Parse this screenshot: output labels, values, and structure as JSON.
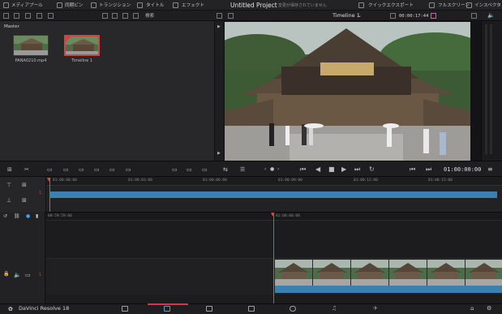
{
  "topbar": {
    "media_pool": "メディアプール",
    "sync_bin": "同期ビン",
    "transitions": "トランジション",
    "titles": "タイトル",
    "effects": "エフェクト",
    "project_title": "Untitled Project",
    "save_status": "変更が保存されていません",
    "quick_export": "クイックエクスポート",
    "fullscreen": "フルスクリーン",
    "inspector": "インスペクタ"
  },
  "toolbar2": {
    "search_label": "検索",
    "timeline_name": "Timeline 1",
    "timecode": "00:00:17:44"
  },
  "media_pool": {
    "bin_label": "Master",
    "clips": [
      {
        "name": "PANA0210.mp4"
      },
      {
        "name": "Timeline 1"
      }
    ]
  },
  "controls": {
    "main_timecode": "01:00:00:00"
  },
  "upper_timeline": {
    "track_number": "1",
    "ruler": [
      "01:00:00:00",
      "01:00:03:00",
      "01:00:06:00",
      "01:00:09:00",
      "01:00:12:00",
      "01:00:15:00"
    ]
  },
  "lower_timeline": {
    "track_number": "1",
    "ruler": [
      "01:00:00:00"
    ],
    "left_ruler": "00:59:59:00"
  },
  "bottombar": {
    "app_name": "DaVinci Resolve 18"
  },
  "colors": {
    "playhead": "#e04b3a",
    "clip_blue": "#3a7fae",
    "active_page": "#e0324a"
  }
}
